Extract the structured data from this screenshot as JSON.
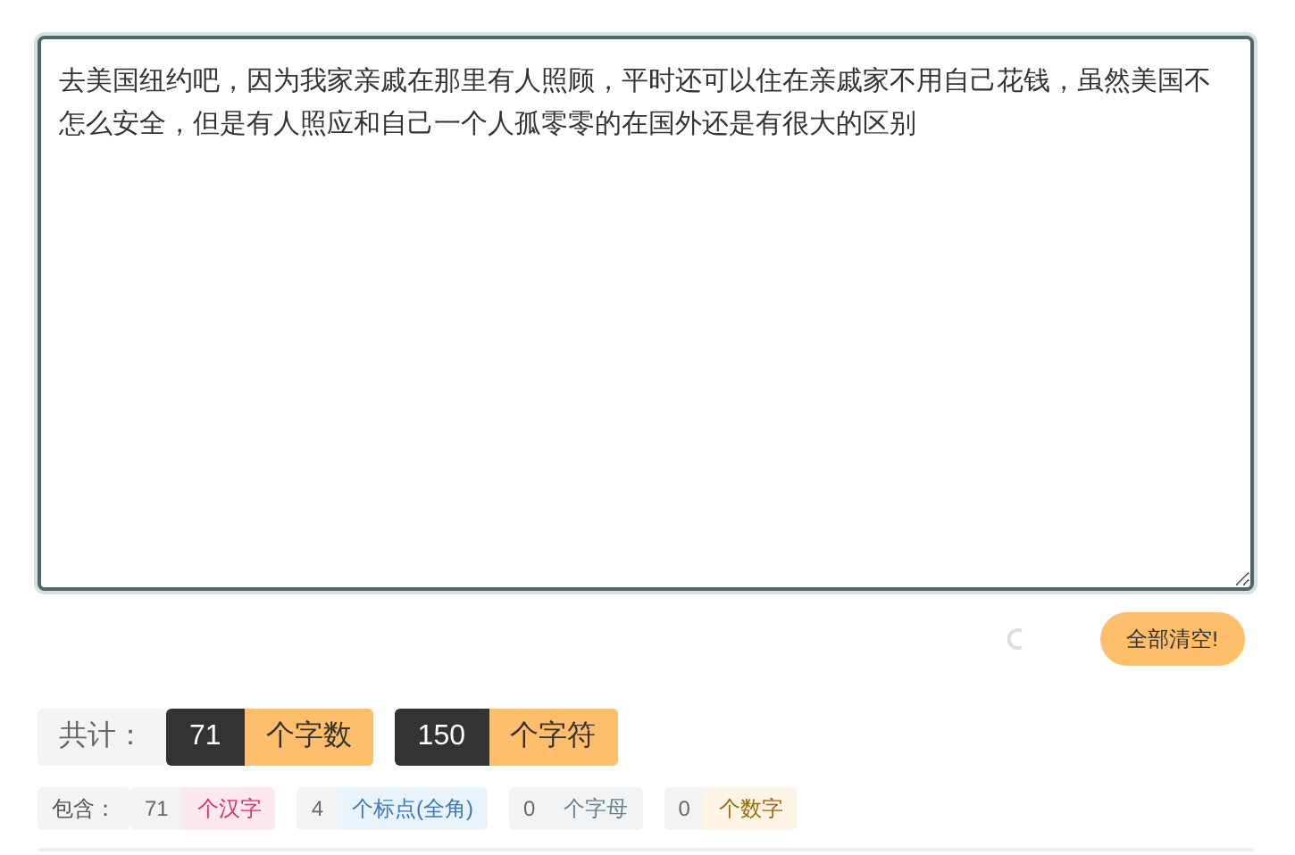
{
  "editor": {
    "value": "去美国纽约吧，因为我家亲戚在那里有人照顾，平时还可以住在亲戚家不用自己花钱，虽然美国不怎么安全，但是有人照应和自己一个人孤零零的在国外还是有很大的区别"
  },
  "clear_button": "全部清空!",
  "totals": {
    "label": "共计：",
    "items": [
      {
        "count": "71",
        "unit": "个字数"
      },
      {
        "count": "150",
        "unit": "个字符"
      }
    ]
  },
  "breakdown": {
    "label": "包含：",
    "items": [
      {
        "count": "71",
        "unit": "个汉字",
        "color": "#d6336c"
      },
      {
        "count": "4",
        "unit": "个标点(全角)",
        "color": "#3a7ab8"
      },
      {
        "count": "0",
        "unit": "个字母",
        "color": "#6a7f8e"
      },
      {
        "count": "0",
        "unit": "个数字",
        "color": "#9a6a10"
      }
    ]
  }
}
